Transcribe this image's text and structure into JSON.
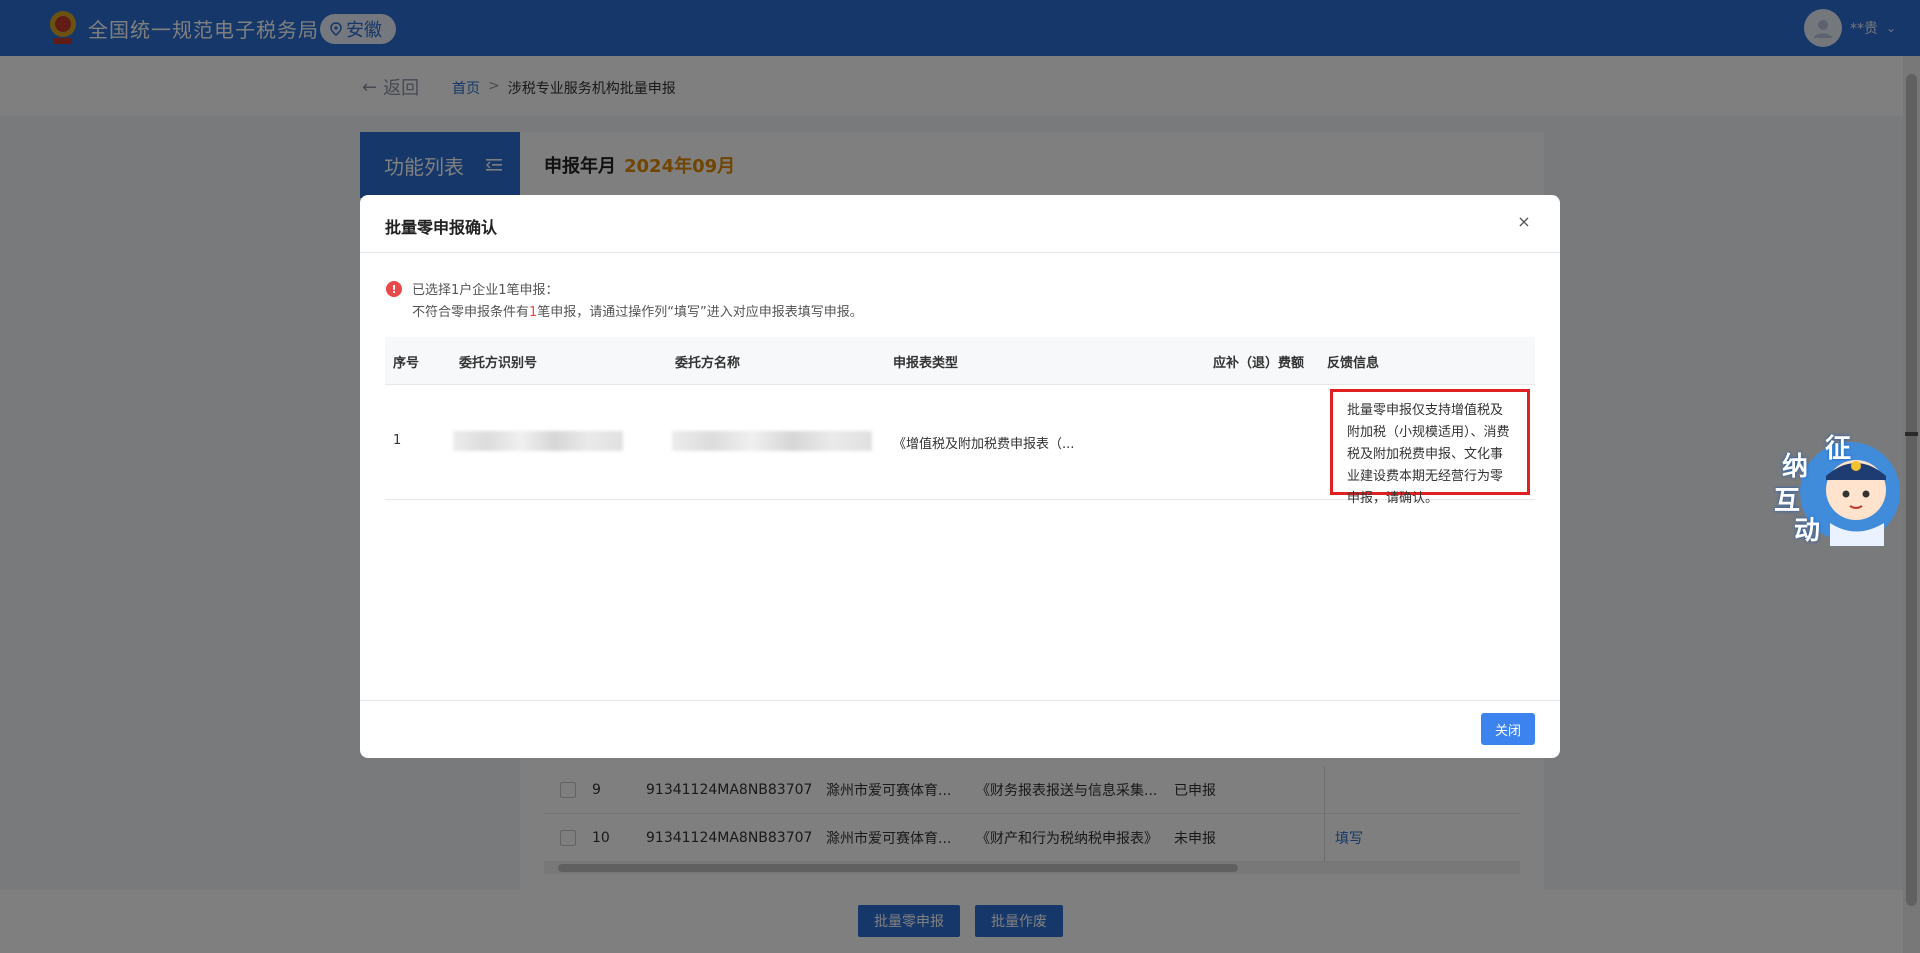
{
  "header": {
    "site_title": "全国统一规范电子税务局",
    "region": "安徽",
    "user_name": "**贵"
  },
  "breadcrumb": {
    "back_label": "返回",
    "home": "首页",
    "separator": ">",
    "current": "涉税专业服务机构批量申报"
  },
  "sidebar": {
    "func_list_label": "功能列表"
  },
  "content": {
    "period_label": "申报年月",
    "period_value": "2024年09月",
    "rows": [
      {
        "idx": "9",
        "id": "91341124MA8NB83707",
        "name": "滁州市爱可赛体育...",
        "type": "《财务报表报送与信息采集...",
        "status": "已申报",
        "action": ""
      },
      {
        "idx": "10",
        "id": "91341124MA8NB83707",
        "name": "滁州市爱可赛体育...",
        "type": "《财产和行为税纳税申报表》",
        "status": "未申报",
        "action": "填写"
      }
    ]
  },
  "bottom": {
    "batch_zero_label": "批量零申报",
    "batch_void_label": "批量作废"
  },
  "modal": {
    "title": "批量零申报确认",
    "close_symbol": "×",
    "alert_icon": "!",
    "alert_line1": "已选择1户企业1笔申报：",
    "alert_line2_pre": "不符合零申报条件有",
    "alert_line2_num": "1",
    "alert_line2_post": "笔申报，请通过操作列“填写”进入对应申报表填写申报。",
    "table": {
      "headers": [
        "序号",
        "委托方识别号",
        "委托方名称",
        "申报表类型",
        "应补（退）费额",
        "反馈信息"
      ],
      "rows": [
        {
          "idx": "1",
          "type": "《增值税及附加税费申报表（...",
          "feedback": "批量零申报仅支持增值税及附加税（小规模适用）、消费税及附加税费申报、文化事业建设费本期无经营行为零申报，请确认。"
        }
      ]
    },
    "close_button": "关闭"
  },
  "assistant": {
    "label_chars": [
      "征",
      "纳",
      "互",
      "动"
    ]
  },
  "colors": {
    "primary": "#2b6fd3",
    "accent_orange": "#e08a00",
    "alert_red": "#e84a4a",
    "highlight_border": "#e02020",
    "button_blue": "#3d83f0"
  }
}
